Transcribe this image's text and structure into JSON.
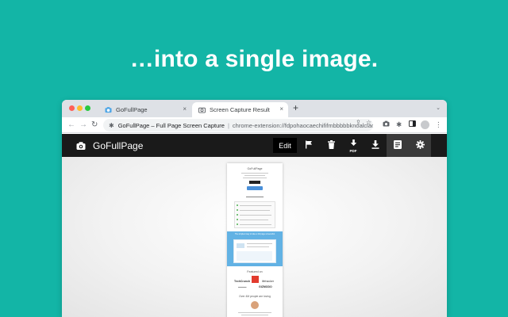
{
  "headline": "…into a single image.",
  "browser": {
    "tabs": [
      {
        "label": "GoFullPage",
        "close": "×"
      },
      {
        "label": "Screen Capture Result",
        "close": "×"
      }
    ],
    "new_tab": "+",
    "tab_menu": "⌄",
    "omnibox": {
      "site_label": "GoFullPage – Full Page Screen Capture",
      "separator": "|",
      "url": "chrome-extension://fdpohaocaechififmbbbbbknoalclacl/capture.html?id=…"
    }
  },
  "app": {
    "title": "GoFullPage",
    "edit_label": "Edit",
    "pdf_label": "PDF"
  },
  "thumbnail": {
    "header_title": "GoFullPage",
    "blue_band_title": "The simplest way to take a full page screenshot",
    "featured_on": "Featured on",
    "logos": [
      "TechCrunch",
      "lifehacker",
      "GIZMODO"
    ],
    "testimonials_title": "Over 4M people are loving"
  },
  "colors": {
    "background": "#13b5a6",
    "appbar": "#1a1a1a",
    "accent_blue": "#62b2e4"
  }
}
